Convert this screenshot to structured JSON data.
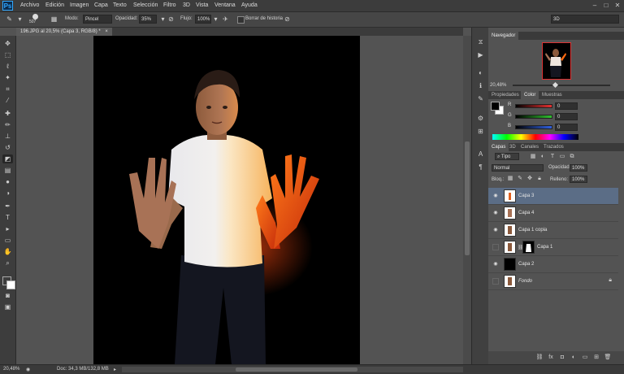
{
  "app": {
    "logo": "Ps"
  },
  "menu": [
    "Archivo",
    "Edición",
    "Imagen",
    "Capa",
    "Texto",
    "Selección",
    "Filtro",
    "3D",
    "Vista",
    "Ventana",
    "Ayuda"
  ],
  "window_controls": {
    "minimize": "–",
    "maximize": "□",
    "close": "✕"
  },
  "options": {
    "brush_size": "507",
    "mode_label": "Modo:",
    "mode_value": "Pincel",
    "opacity_label": "Opacidad:",
    "opacity_value": "35%",
    "flow_label": "Flujo:",
    "flow_value": "100%",
    "erase_history_label": "Borrar de historia",
    "workspace": "3D"
  },
  "document": {
    "tab_title": "196.JPG al 20,5% (Capa 3, RGB/8) *",
    "close": "×"
  },
  "status": {
    "zoom": "20,48%",
    "doc_info": "Doc: 34,3 MB/132,8 MB"
  },
  "navigator": {
    "title": "Navegador",
    "zoom": "20,48%"
  },
  "color_panel": {
    "tabs": [
      "Propiedades",
      "Color",
      "Muestras"
    ],
    "active_tab": "Color",
    "channels": [
      {
        "label": "R",
        "value": "0",
        "color": "#e53030"
      },
      {
        "label": "G",
        "value": "0",
        "color": "#30c030"
      },
      {
        "label": "B",
        "value": "0",
        "color": "#3060e0"
      }
    ]
  },
  "layers_panel": {
    "tabs": [
      "Capas",
      "3D",
      "Canales",
      "Trazados"
    ],
    "active_tab": "Capas",
    "filter_kind": "Tipo",
    "blend_mode": "Normal",
    "opacity_label": "Opacidad:",
    "opacity_value": "100%",
    "lock_label": "Bloq.:",
    "fill_label": "Relleno:",
    "fill_value": "100%",
    "layers": [
      {
        "name": "Capa 3",
        "visible": true,
        "selected": true
      },
      {
        "name": "Capa 4",
        "visible": true,
        "selected": false
      },
      {
        "name": "Capa 1 copia",
        "visible": true,
        "selected": false
      },
      {
        "name": "Capa 1",
        "visible": false,
        "selected": false
      },
      {
        "name": "Capa 2",
        "visible": true,
        "selected": false
      },
      {
        "name": "Fondo",
        "visible": false,
        "selected": false,
        "locked": true
      }
    ]
  },
  "colors": {
    "accent_selected": "#5b6d86",
    "foreground": "#000000",
    "background": "#ffffff"
  }
}
